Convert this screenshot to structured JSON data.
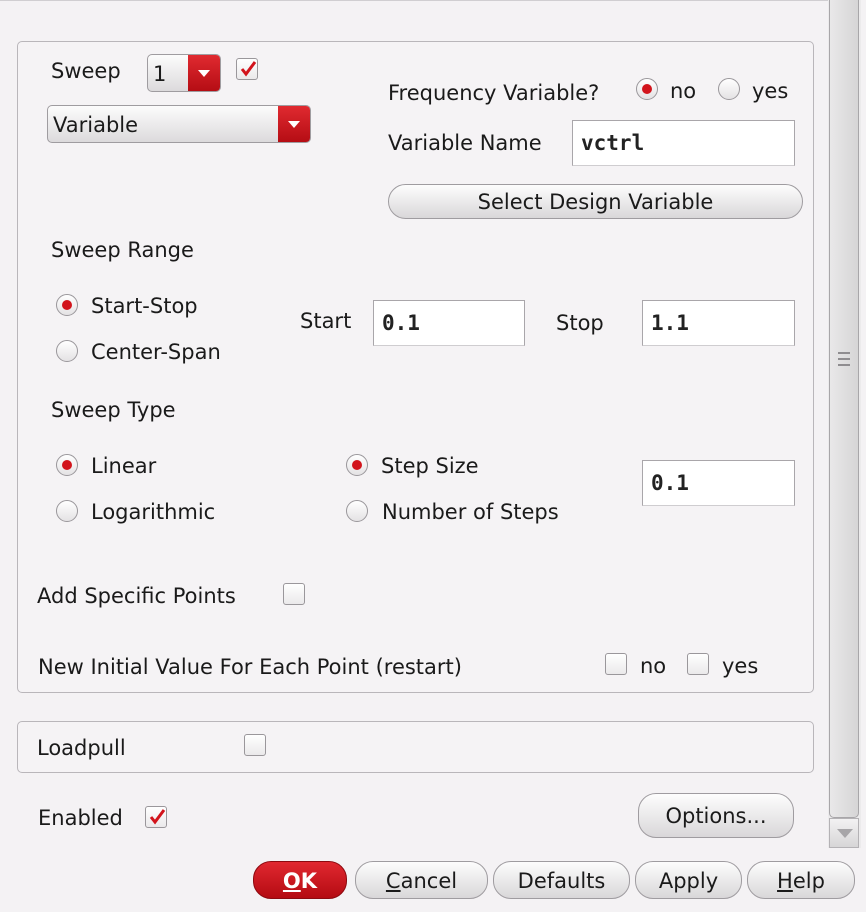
{
  "sweep": {
    "label": "Sweep",
    "number_value": "1",
    "enabled_checked": true,
    "sweep_by_value": "Variable",
    "frequency_variable": {
      "label": "Frequency Variable?",
      "options": [
        "no",
        "yes"
      ],
      "selected": "no"
    },
    "variable_name": {
      "label": "Variable Name",
      "value": "vctrl"
    },
    "select_design_variable_label": "Select Design Variable"
  },
  "sweep_range": {
    "title": "Sweep Range",
    "options": [
      "Start-Stop",
      "Center-Span"
    ],
    "selected": "Start-Stop",
    "start_label": "Start",
    "start_value": "0.1",
    "stop_label": "Stop",
    "stop_value": "1.1"
  },
  "sweep_type": {
    "title": "Sweep Type",
    "scale_options": [
      "Linear",
      "Logarithmic"
    ],
    "scale_selected": "Linear",
    "step_options": [
      "Step Size",
      "Number of Steps"
    ],
    "step_selected": "Step Size",
    "step_value": "0.1"
  },
  "add_specific_points": {
    "label": "Add Specific Points",
    "checked": false
  },
  "restart": {
    "label": "New Initial Value For Each Point (restart)",
    "options": [
      "no",
      "yes"
    ],
    "no_checked": false,
    "yes_checked": false
  },
  "loadpull": {
    "label": "Loadpull",
    "checked": false
  },
  "enabled": {
    "label": "Enabled",
    "checked": true
  },
  "options_button_label": "Options...",
  "buttons": {
    "ok": "OK",
    "cancel": "Cancel",
    "defaults": "Defaults",
    "apply": "Apply",
    "help": "Help"
  },
  "colors": {
    "accent": "#d2141c",
    "background": "#f4f2f4",
    "border": "#b9b6ba"
  },
  "icons": {
    "check": "checkmark-icon",
    "dropdown": "chevron-down-icon",
    "scroll_down": "arrow-down-icon",
    "scroll_grip": "grip-icon"
  }
}
